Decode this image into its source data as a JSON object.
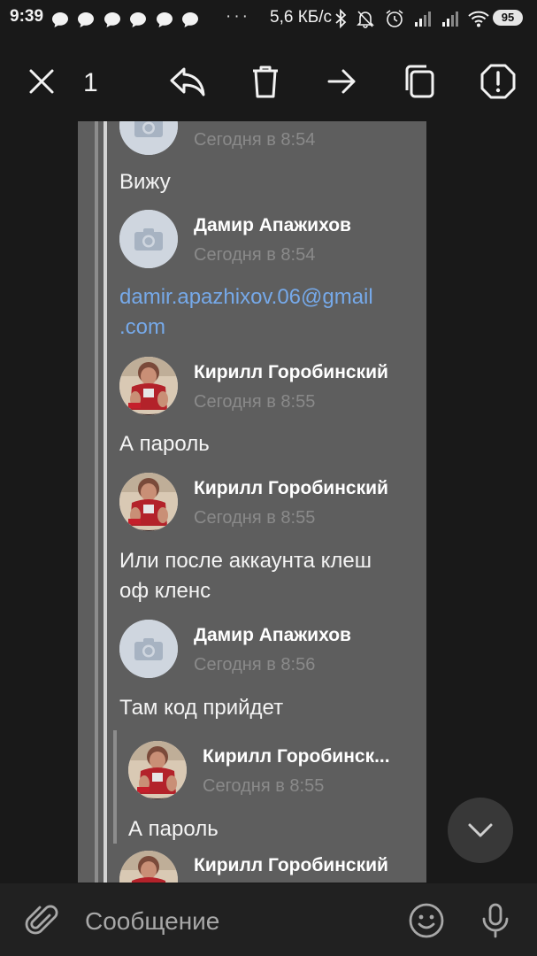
{
  "status_bar": {
    "time": "9:39",
    "speed": "5,6 КБ/с",
    "battery": "95",
    "more_dots": "···"
  },
  "action_bar": {
    "selected_count": "1",
    "icons": [
      "close-icon",
      "reply-icon",
      "delete-icon",
      "forward-icon",
      "copy-icon",
      "report-icon"
    ]
  },
  "messages": [
    {
      "type": "time_only",
      "time": "Сегодня в 8:54"
    },
    {
      "type": "text",
      "text": "Вижу"
    },
    {
      "type": "header",
      "name": "Дамир Апажихов",
      "time": "Сегодня в 8:54",
      "avatar": "camera-placeholder"
    },
    {
      "type": "link",
      "text_line1": "damir.apazhixov.06@gmail",
      "text_line2": ".com"
    },
    {
      "type": "header",
      "name": "Кирилл Горобинский",
      "time": "Сегодня в 8:55",
      "avatar": "photo"
    },
    {
      "type": "text",
      "text": "А пароль"
    },
    {
      "type": "header",
      "name": "Кирилл Горобинский",
      "time": "Сегодня в 8:55",
      "avatar": "photo"
    },
    {
      "type": "text",
      "line1": "Или после аккаунта клеш",
      "line2": "оф кленс"
    },
    {
      "type": "header",
      "name": "Дамир Апажихов",
      "time": "Сегодня в 8:56",
      "avatar": "camera-placeholder"
    },
    {
      "type": "text",
      "text": "Там код прийдет"
    },
    {
      "type": "quoted_header",
      "name": "Кирилл Горобинск...",
      "time": "Сегодня в 8:55",
      "avatar": "photo"
    },
    {
      "type": "quoted_text",
      "text": "А пароль"
    },
    {
      "type": "header",
      "name": "Кирилл Горобинский",
      "avatar": "photo"
    }
  ],
  "input": {
    "placeholder": "Сообщение"
  },
  "colors": {
    "background": "#191919",
    "card": "#5e5e5e",
    "link": "#76a9e9",
    "time": "#8a8a8a"
  }
}
